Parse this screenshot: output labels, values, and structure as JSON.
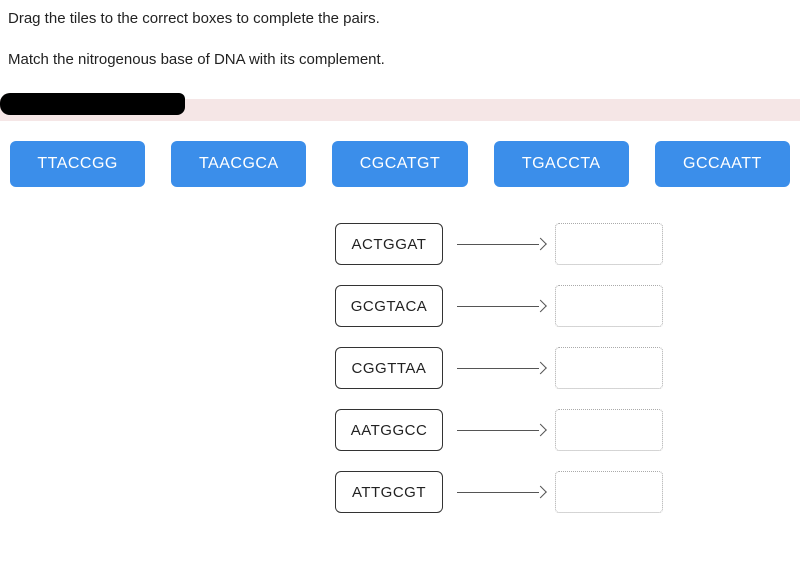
{
  "instructions": {
    "line1": "Drag the tiles to the correct boxes to complete the pairs.",
    "line2": "Match the nitrogenous base of DNA with its complement."
  },
  "tiles": [
    {
      "label": "TTACCGG"
    },
    {
      "label": "TAACGCA"
    },
    {
      "label": "CGCATGT"
    },
    {
      "label": "TGACCTA"
    },
    {
      "label": "GCCAATT"
    }
  ],
  "pairs": [
    {
      "source": "ACTGGAT"
    },
    {
      "source": "GCGTACA"
    },
    {
      "source": "CGGTTAA"
    },
    {
      "source": "AATGGCC"
    },
    {
      "source": "ATTGCGT"
    }
  ]
}
